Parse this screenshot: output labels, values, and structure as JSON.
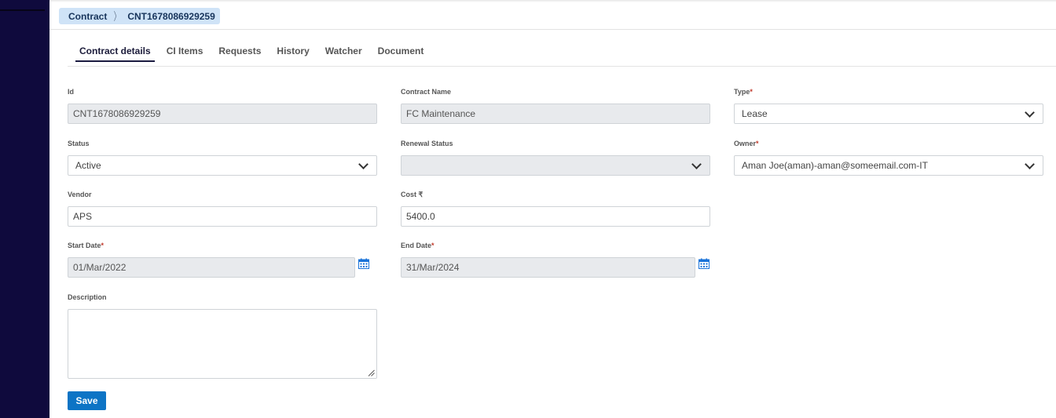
{
  "breadcrumb": {
    "parent": "Contract",
    "current": "CNT1678086929259"
  },
  "tabs": [
    {
      "label": "Contract details",
      "active": true
    },
    {
      "label": "CI Items"
    },
    {
      "label": "Requests"
    },
    {
      "label": "History"
    },
    {
      "label": "Watcher"
    },
    {
      "label": "Document"
    }
  ],
  "form": {
    "id": {
      "label": "Id",
      "value": "CNT1678086929259"
    },
    "contract_name": {
      "label": "Contract Name",
      "value": "FC Maintenance"
    },
    "type": {
      "label": "Type",
      "required": "*",
      "value": "Lease"
    },
    "status": {
      "label": "Status",
      "value": "Active"
    },
    "renewal_status": {
      "label": "Renewal Status",
      "value": ""
    },
    "owner": {
      "label": "Owner",
      "required": "*",
      "value": "Aman Joe(aman)-aman@someemail.com-IT"
    },
    "vendor": {
      "label": "Vendor",
      "value": "APS"
    },
    "cost": {
      "label": "Cost ₹",
      "value": "5400.0"
    },
    "start_date": {
      "label": "Start Date",
      "required": "*",
      "value": "01/Mar/2022"
    },
    "end_date": {
      "label": "End Date",
      "required": "*",
      "value": "31/Mar/2024"
    },
    "description": {
      "label": "Description",
      "value": ""
    }
  },
  "actions": {
    "save_label": "Save"
  },
  "colors": {
    "sidebar": "#0f0a3d",
    "primary_button": "#0d74c5",
    "breadcrumb_bg": "#cfe3f7",
    "readonly_bg": "#e8eaed"
  }
}
